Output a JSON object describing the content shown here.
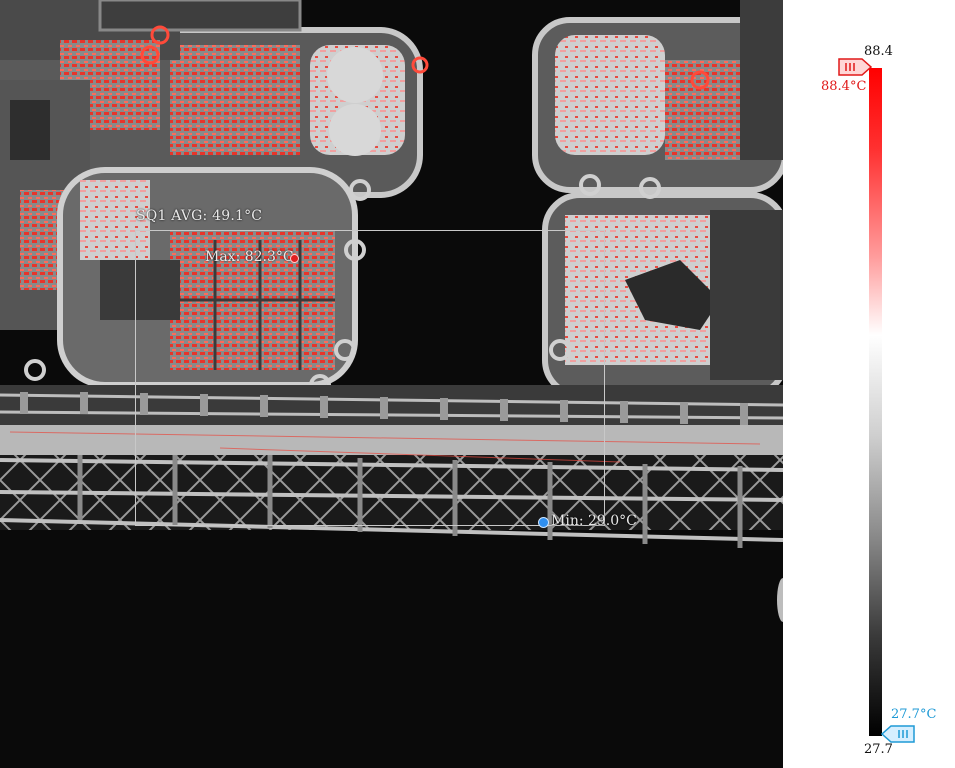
{
  "measurements": {
    "roi_label": "SQ1 AVG: 49.1°C",
    "max_label": "Max: 82.3°C",
    "min_label": "Min: 29.0°C"
  },
  "palette": {
    "max_value": "88.4",
    "min_value": "27.7",
    "high_marker_label": "88.4°C",
    "low_marker_label": "27.7°C",
    "high_color": "#e01818",
    "low_color": "#1f9ad6"
  },
  "icons": {
    "high_marker": "slider-tag-icon",
    "low_marker": "slider-tag-icon"
  }
}
